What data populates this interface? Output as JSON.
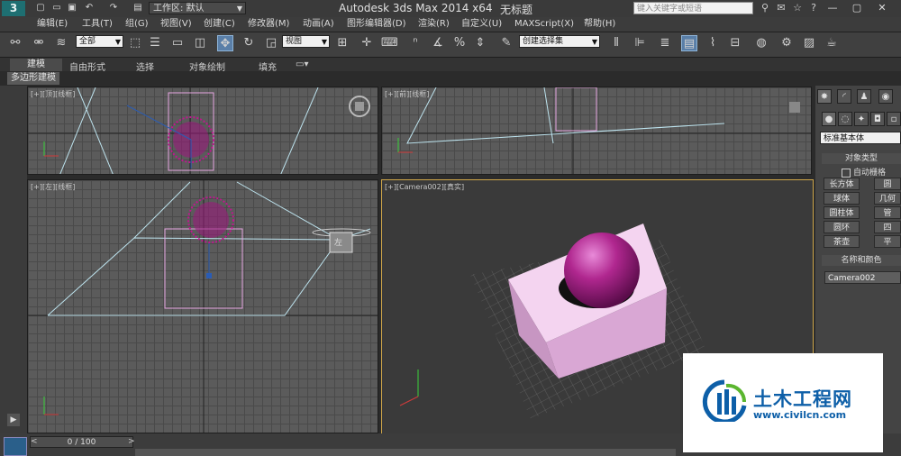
{
  "titlebar": {
    "logo": "3",
    "workspace": "工作区: 默认",
    "app_title": "Autodesk 3ds Max  2014 x64",
    "doc_title": "无标题",
    "search_placeholder": "键入关键字或短语",
    "icons": [
      "search-icon",
      "binoculars-icon",
      "star-icon",
      "help-icon",
      "user-icon"
    ],
    "window_buttons": [
      "—",
      "▢",
      "✕"
    ]
  },
  "menu": {
    "items": [
      "编辑(E)",
      "工具(T)",
      "组(G)",
      "视图(V)",
      "创建(C)",
      "修改器(M)",
      "动画(A)",
      "图形编辑器(D)",
      "渲染(R)",
      "自定义(U)",
      "MAXScript(X)",
      "帮助(H)"
    ]
  },
  "toolbar": {
    "selection_filter": "全部",
    "ref_coord": "视图",
    "named_selection": "创建选择集"
  },
  "ribbon": {
    "tabs": [
      "建模",
      "自由形式",
      "选择",
      "对象绘制",
      "填充"
    ],
    "sub_label": "多边形建模"
  },
  "viewports": {
    "top_left": "[+][顶][线框]",
    "top_right": "[+][前][线框]",
    "bottom_left": "[+][左][线框]",
    "camera": "[+][Camera002][真实]",
    "viewcube_label": "左"
  },
  "command_panel": {
    "category": "标准基本体",
    "object_type_header": "对象类型",
    "autogrid": "自动栅格",
    "buttons": [
      [
        "长方体",
        "圆"
      ],
      [
        "球体",
        "几何"
      ],
      [
        "圆柱体",
        "管"
      ],
      [
        "圆环",
        "四"
      ],
      [
        "茶壶",
        "平"
      ]
    ],
    "name_color_header": "名称和颜色",
    "object_name": "Camera002"
  },
  "timeline": {
    "position": "0 / 100"
  },
  "watermark": {
    "title": "土木工程网",
    "url": "www.civilcn.com"
  },
  "colors": {
    "accent_selected_viewport": "#cfa64a",
    "sphere": "#b0278f",
    "box": "#f0c8ec",
    "wireframe": "#9fd9e8"
  }
}
